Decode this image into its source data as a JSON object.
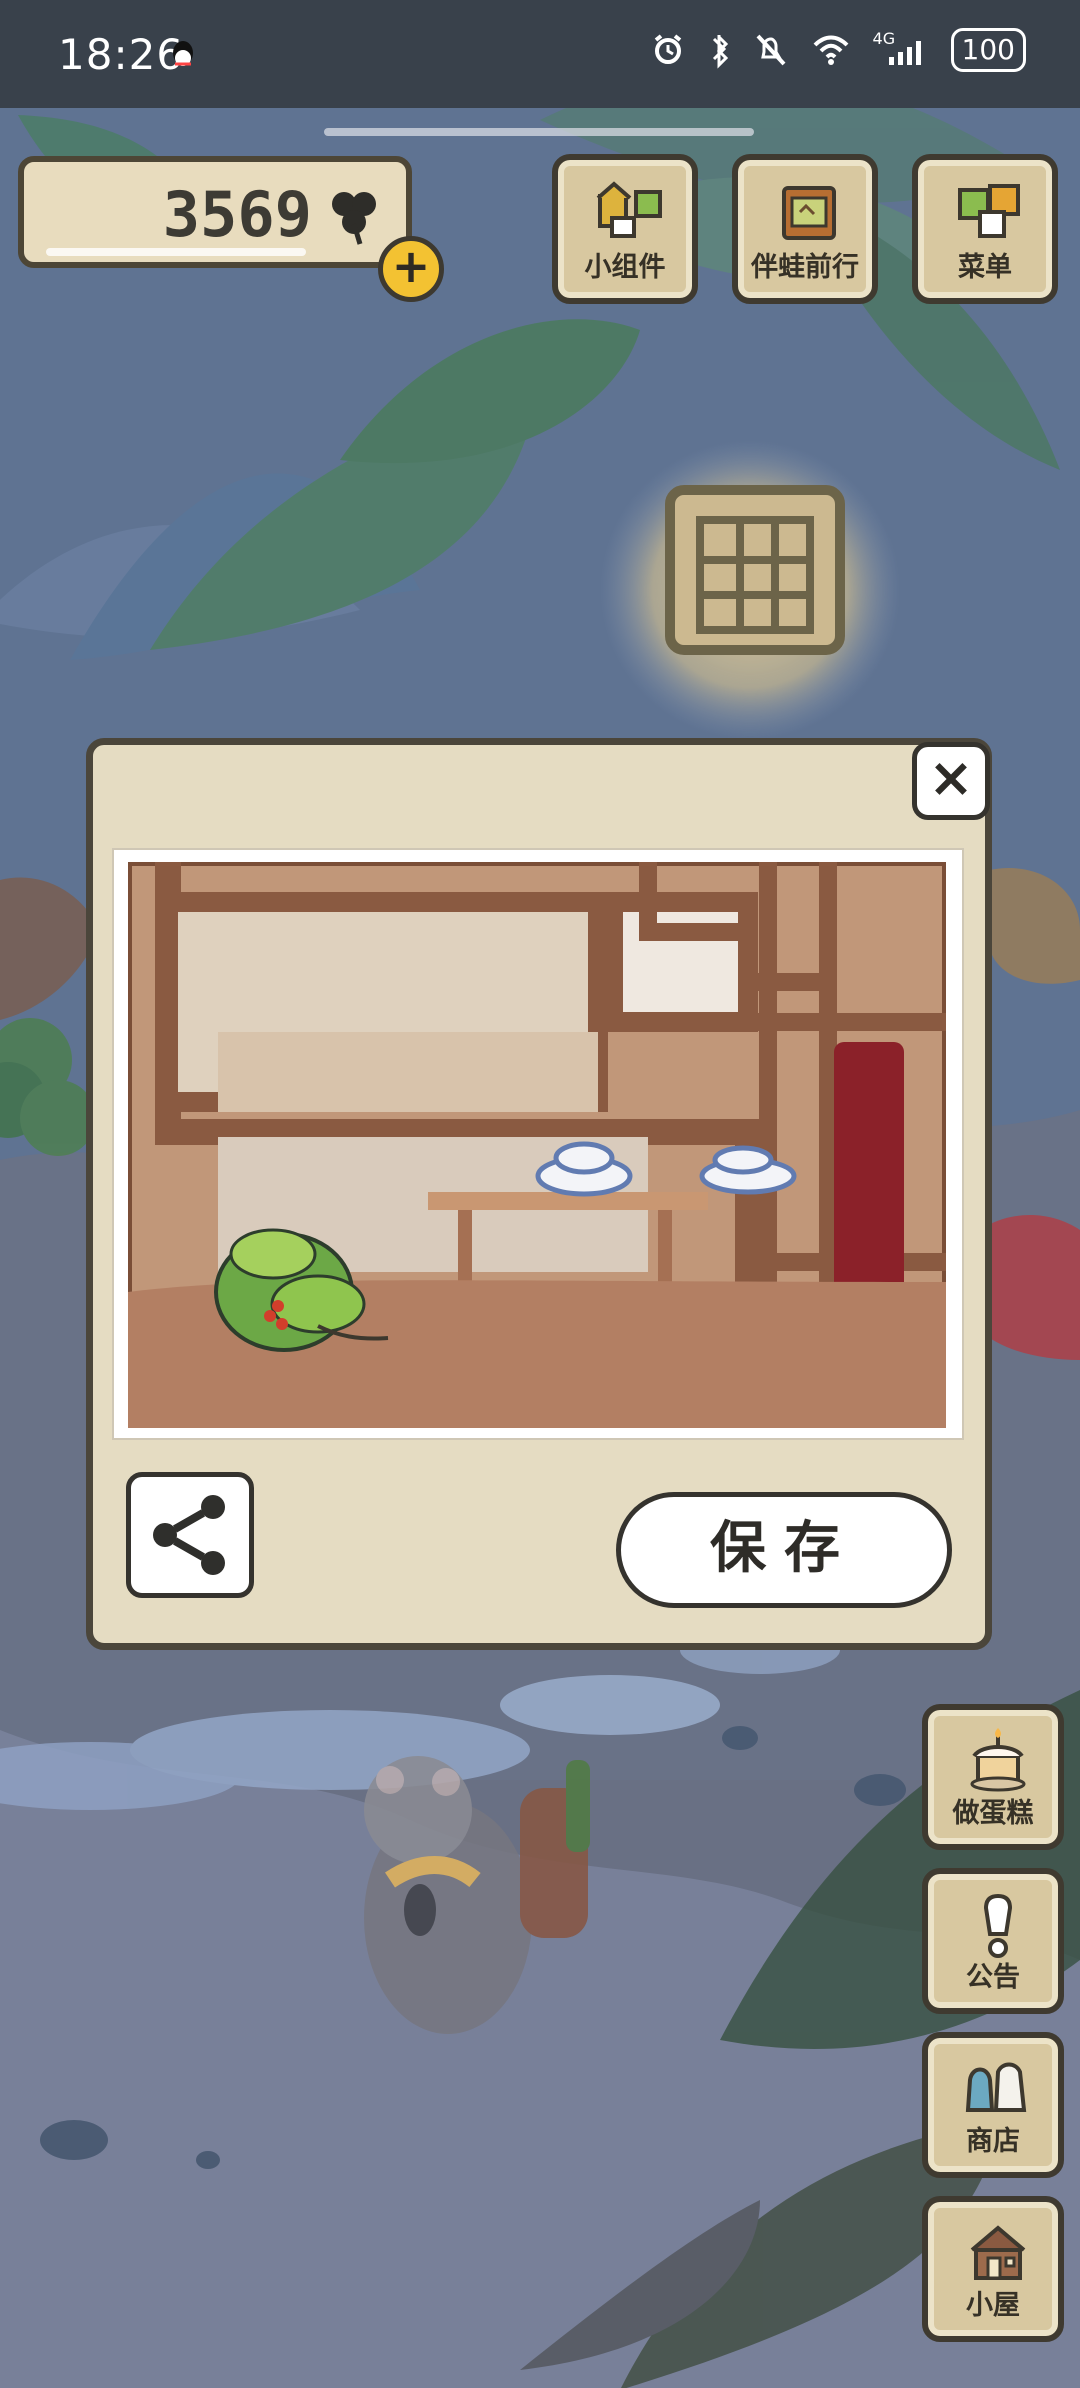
{
  "status_bar": {
    "time": "18:26",
    "network": "4G",
    "battery": "100"
  },
  "top_bar": {
    "clover_count": "3569",
    "menu_buttons": [
      {
        "label": "小组件",
        "icon": "widget-icon"
      },
      {
        "label": "伴蛙前行",
        "icon": "travel-book-icon"
      },
      {
        "label": "菜单",
        "icon": "menu-cards-icon"
      }
    ]
  },
  "dialog": {
    "save_label": "保存",
    "close_symbol": "×"
  },
  "side_buttons": [
    {
      "label": "做蛋糕",
      "icon": "cake-icon"
    },
    {
      "label": "公告",
      "icon": "notice-icon"
    },
    {
      "label": "商店",
      "icon": "shop-bags-icon"
    },
    {
      "label": "小屋",
      "icon": "house-icon"
    }
  ],
  "colors": {
    "overlay": "#5d6f8d",
    "panel": "#e5dcc2",
    "outline": "#3f3a30"
  }
}
